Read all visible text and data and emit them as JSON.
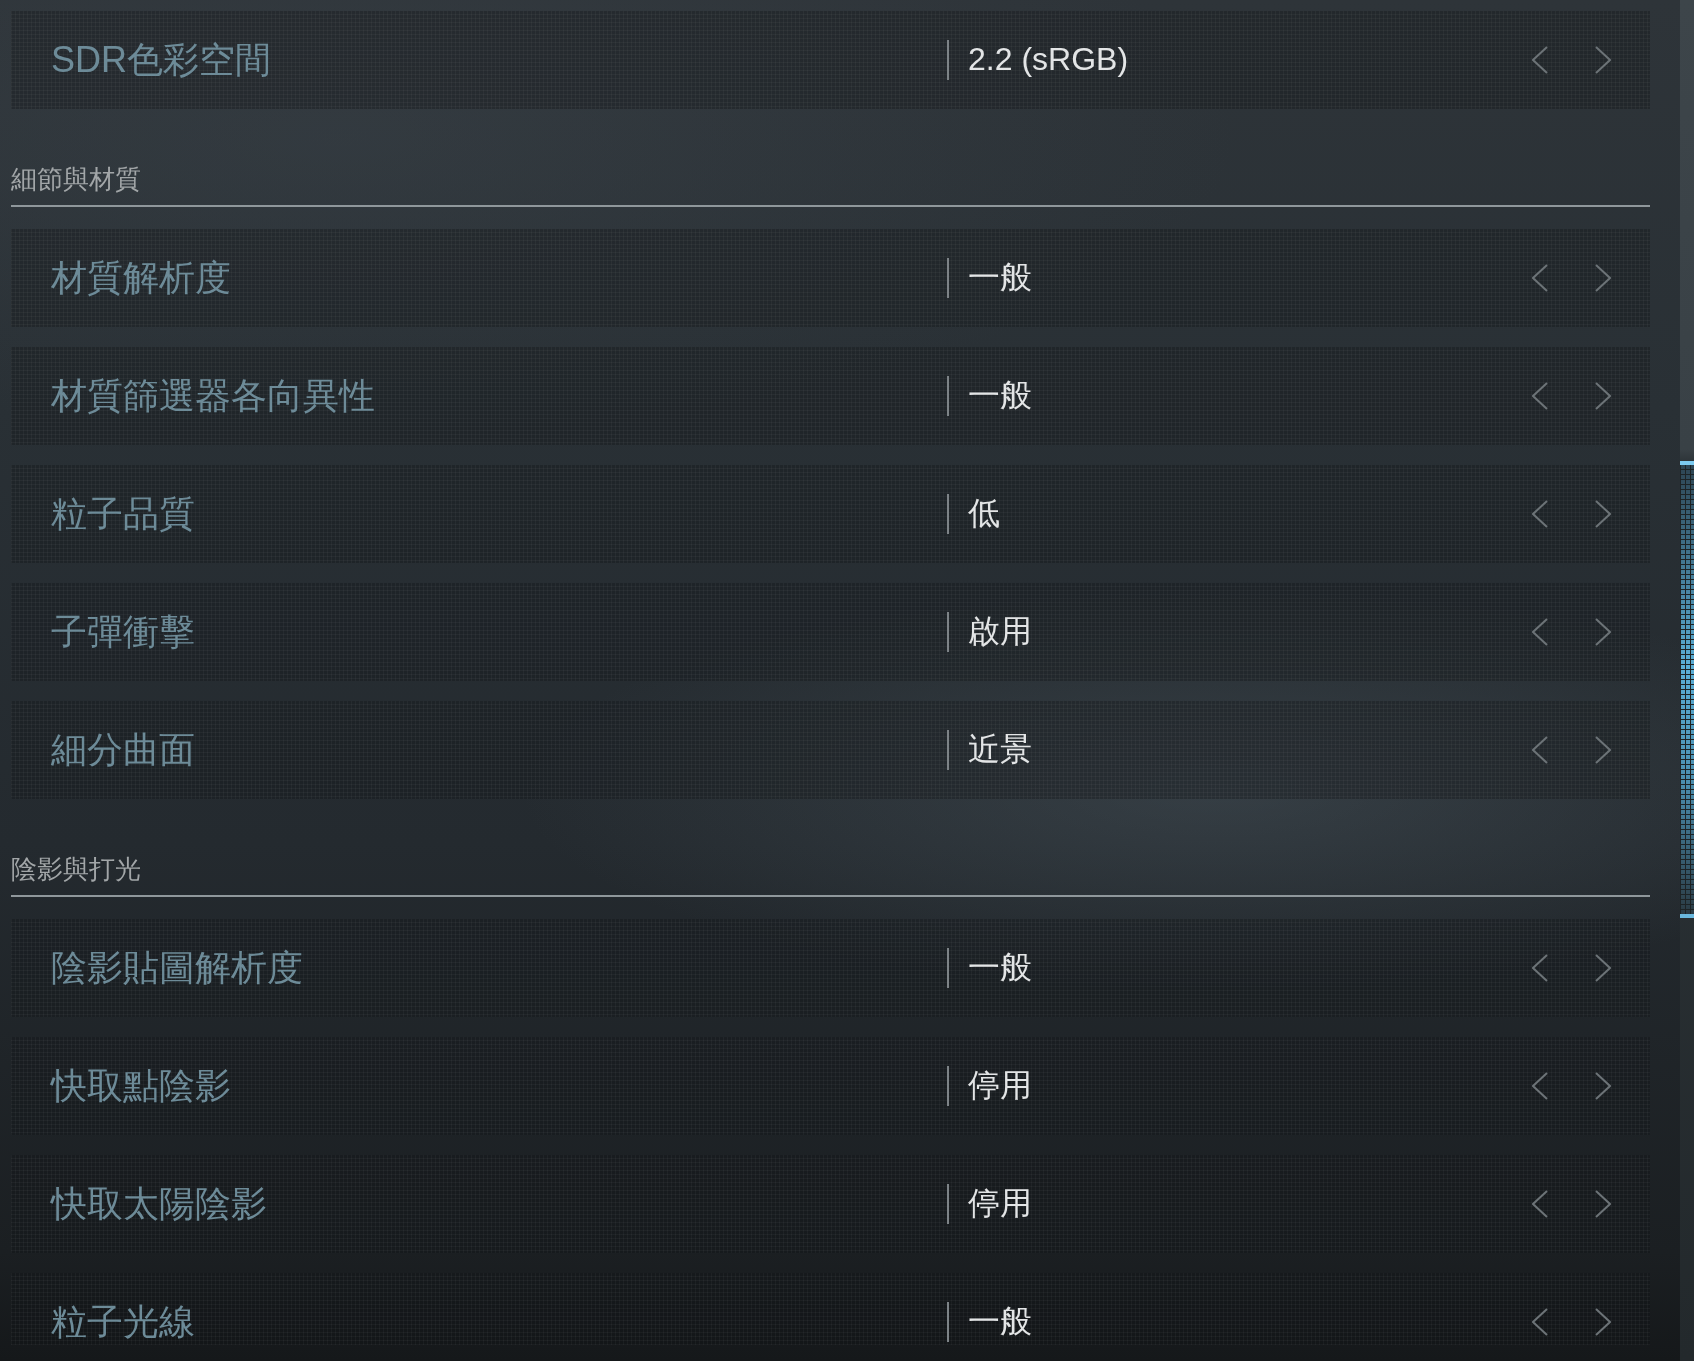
{
  "groups": [
    {
      "rows": [
        {
          "label": "SDR色彩空間",
          "value": "2.2 (sRGB)"
        }
      ]
    },
    {
      "title": "細節與材質",
      "rows": [
        {
          "label": "材質解析度",
          "value": "一般"
        },
        {
          "label": "材質篩選器各向異性",
          "value": "一般"
        },
        {
          "label": "粒子品質",
          "value": "低"
        },
        {
          "label": "子彈衝擊",
          "value": "啟用"
        },
        {
          "label": "細分曲面",
          "value": "近景"
        }
      ]
    },
    {
      "title": "陰影與打光",
      "rows": [
        {
          "label": "陰影貼圖解析度",
          "value": "一般"
        },
        {
          "label": "快取點陰影",
          "value": "停用"
        },
        {
          "label": "快取太陽陰影",
          "value": "停用"
        },
        {
          "label": "粒子光線",
          "value": "一般"
        }
      ]
    }
  ]
}
